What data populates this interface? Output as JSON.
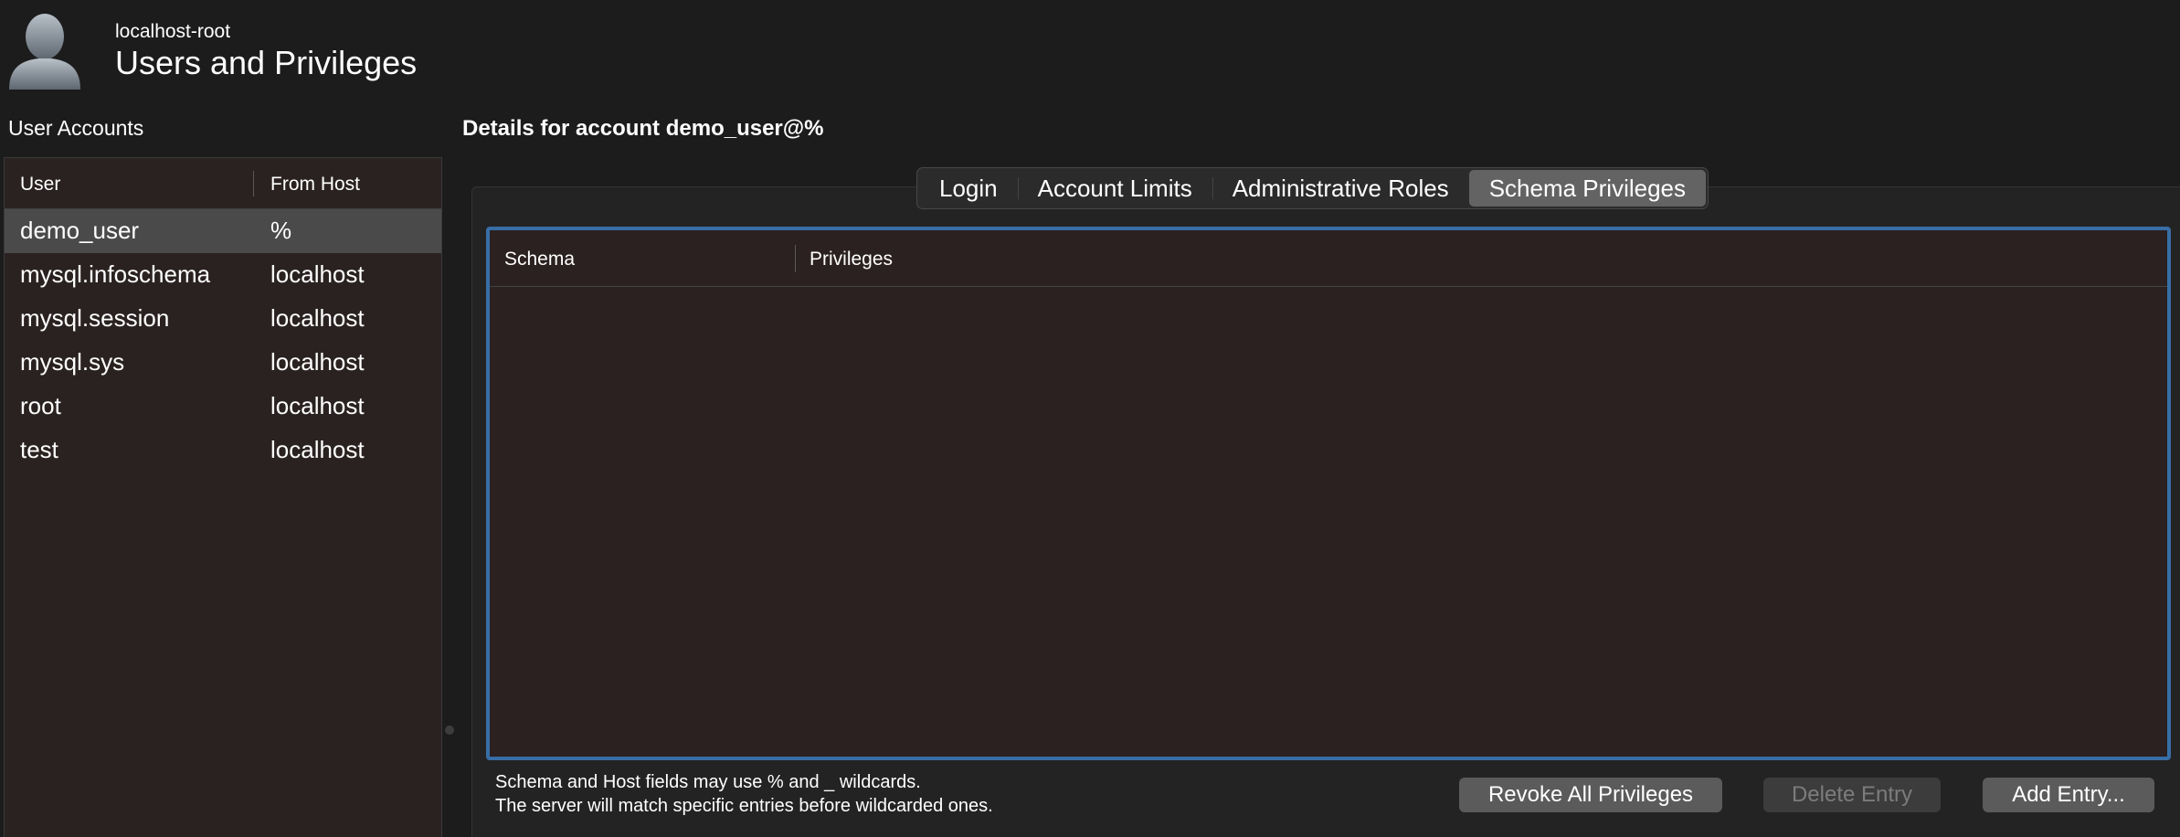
{
  "header": {
    "subtitle": "localhost-root",
    "title": "Users and Privileges",
    "avatar_icon": "user-silhouette-icon"
  },
  "user_accounts": {
    "label": "User Accounts",
    "columns": [
      "User",
      "From Host"
    ],
    "rows": [
      {
        "user": "demo_user",
        "host": "%",
        "selected": true
      },
      {
        "user": "mysql.infoschema",
        "host": "localhost",
        "selected": false
      },
      {
        "user": "mysql.session",
        "host": "localhost",
        "selected": false
      },
      {
        "user": "mysql.sys",
        "host": "localhost",
        "selected": false
      },
      {
        "user": "root",
        "host": "localhost",
        "selected": false
      },
      {
        "user": "test",
        "host": "localhost",
        "selected": false
      }
    ]
  },
  "details": {
    "title": "Details for account demo_user@%",
    "tabs": [
      {
        "label": "Login",
        "active": false
      },
      {
        "label": "Account Limits",
        "active": false
      },
      {
        "label": "Administrative Roles",
        "active": false
      },
      {
        "label": "Schema Privileges",
        "active": true
      }
    ],
    "schema_table": {
      "columns": [
        "Schema",
        "Privileges"
      ],
      "rows": []
    },
    "note_line1": "Schema and Host fields may use % and _ wildcards.",
    "note_line2": "The server will match specific entries before wildcarded ones.",
    "buttons": {
      "revoke": "Revoke All Privileges",
      "delete": "Delete Entry",
      "add": "Add Entry..."
    }
  },
  "colors": {
    "focus_border": "#386ea6",
    "selected_row": "#4a4a4a",
    "active_tab": "#636363"
  }
}
